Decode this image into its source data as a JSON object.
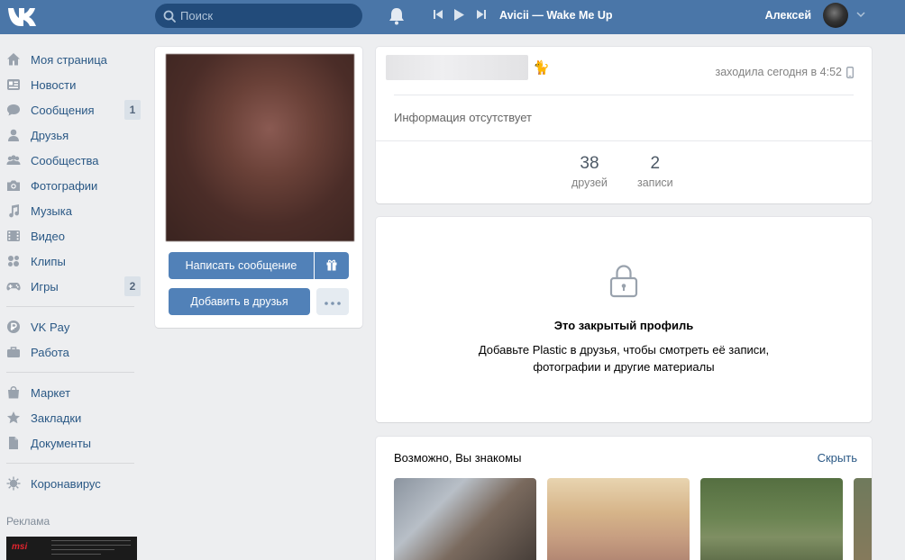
{
  "header": {
    "search_placeholder": "Поиск",
    "now_playing": "Avicii — Wake Me Up",
    "user_name": "Алексей"
  },
  "menu": {
    "items": [
      {
        "label": "Моя страница",
        "icon": "home-icon"
      },
      {
        "label": "Новости",
        "icon": "news-icon"
      },
      {
        "label": "Сообщения",
        "icon": "messages-icon",
        "count": "1"
      },
      {
        "label": "Друзья",
        "icon": "friends-icon"
      },
      {
        "label": "Сообщества",
        "icon": "groups-icon"
      },
      {
        "label": "Фотографии",
        "icon": "camera-icon"
      },
      {
        "label": "Музыка",
        "icon": "music-icon"
      },
      {
        "label": "Видео",
        "icon": "video-icon"
      },
      {
        "label": "Клипы",
        "icon": "clips-icon"
      },
      {
        "label": "Игры",
        "icon": "gamepad-icon",
        "count": "2"
      },
      {
        "label": "VK Pay",
        "icon": "vkpay-icon"
      },
      {
        "label": "Работа",
        "icon": "briefcase-icon"
      },
      {
        "label": "Маркет",
        "icon": "market-icon"
      },
      {
        "label": "Закладки",
        "icon": "star-icon"
      },
      {
        "label": "Документы",
        "icon": "document-icon"
      },
      {
        "label": "Коронавирус",
        "icon": "virus-icon"
      }
    ],
    "ads_title": "Реклама",
    "ad_brand": "msi"
  },
  "profile": {
    "write_message_label": "Написать сообщение",
    "add_friend_label": "Добавить в друзья",
    "last_seen": "заходила сегодня в 4:52",
    "no_info": "Информация отсутствует",
    "friends_count": "38",
    "friends_caption": "друзей",
    "posts_count": "2",
    "posts_caption": "записи"
  },
  "closed": {
    "title": "Это закрытый профиль",
    "text": "Добавьте Plastic в друзья, чтобы смотреть её записи, фотографии и другие материалы"
  },
  "suggestions": {
    "title": "Возможно, Вы знакомы",
    "hide_label": "Скрыть"
  },
  "colors": {
    "header_bg": "#4a76a8",
    "page_bg": "#edeef0",
    "link": "#2a5885",
    "button": "#5181b8"
  }
}
